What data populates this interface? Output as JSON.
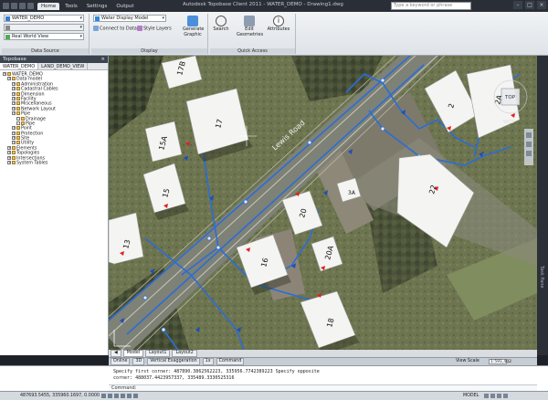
{
  "window": {
    "title": "Autodesk Topobase Client 2011 - WATER_DEMO - Drawing1.dwg",
    "search_placeholder": "Type a keyword or phrase"
  },
  "ribbon_tabs": [
    "Home",
    "Tools",
    "Settings",
    "Output"
  ],
  "ribbon": {
    "data_source": {
      "workspace": "WATER_DEMO",
      "view": "Real World View",
      "panel_title": "Data Source"
    },
    "display": {
      "display_model": "Water Display Model",
      "connect_label": "Connect to Data...",
      "style_layers_label": "Style Layers",
      "generate_graphic_label": "Generate Graphic",
      "panel_title": "Display"
    },
    "quick_access": {
      "search_label": "Search",
      "edit_geometries_label": "Edit Geometries",
      "attributes_label": "Attributes",
      "panel_title": "Quick Access"
    }
  },
  "palette": {
    "title": "Topobase",
    "tabs": [
      "WATER_DEMO",
      "LAND_DEMO_VIEW"
    ],
    "tree": [
      {
        "label": "WATER_DEMO",
        "level": 0
      },
      {
        "label": "Data model",
        "level": 1
      },
      {
        "label": "Administration",
        "level": 2
      },
      {
        "label": "Cadastral Cables",
        "level": 2
      },
      {
        "label": "Dimension",
        "level": 2
      },
      {
        "label": "Facility",
        "level": 2
      },
      {
        "label": "Miscellaneous",
        "level": 2
      },
      {
        "label": "Network Layout",
        "level": 2
      },
      {
        "label": "Pipe",
        "level": 2
      },
      {
        "label": "Drainage",
        "level": 3
      },
      {
        "label": "Pipe",
        "level": 3
      },
      {
        "label": "Point",
        "level": 2
      },
      {
        "label": "Protection",
        "level": 2
      },
      {
        "label": "Site",
        "level": 2
      },
      {
        "label": "Utility",
        "level": 2
      },
      {
        "label": "Elements",
        "level": 1
      },
      {
        "label": "Topologies",
        "level": 1
      },
      {
        "label": "Intersections",
        "level": 1
      },
      {
        "label": "System Tables",
        "level": 1
      }
    ]
  },
  "map": {
    "street_label": "Lewis Road",
    "buildings": [
      "17B",
      "17",
      "15A",
      "15",
      "13",
      "16",
      "20",
      "20A",
      "18",
      "22",
      "2",
      "2A",
      "3A"
    ],
    "viewcube_label": "TOP",
    "viewcube_sub": "WCS"
  },
  "right_strip_label": "Task Pane",
  "layout_tabs": [
    "Model",
    "Layout1",
    "Layout2"
  ],
  "map_status": {
    "items": [
      "Online",
      "3D",
      "Vertical Exaggeration",
      "1x",
      "Command"
    ],
    "view_scale_label": "View Scale",
    "view_scale_value": "1:591,402"
  },
  "command": {
    "lines": [
      "Specify first corner: 487890.3862562223, 335956.7742389223 Specify opposite",
      "corner: 488037.4423957337, 335489.3330525316"
    ],
    "prompt": "Command:"
  },
  "statusbar": {
    "coordinates": "487693.5455, 335960.1697, 0.0000",
    "model_label": "MODEL"
  }
}
